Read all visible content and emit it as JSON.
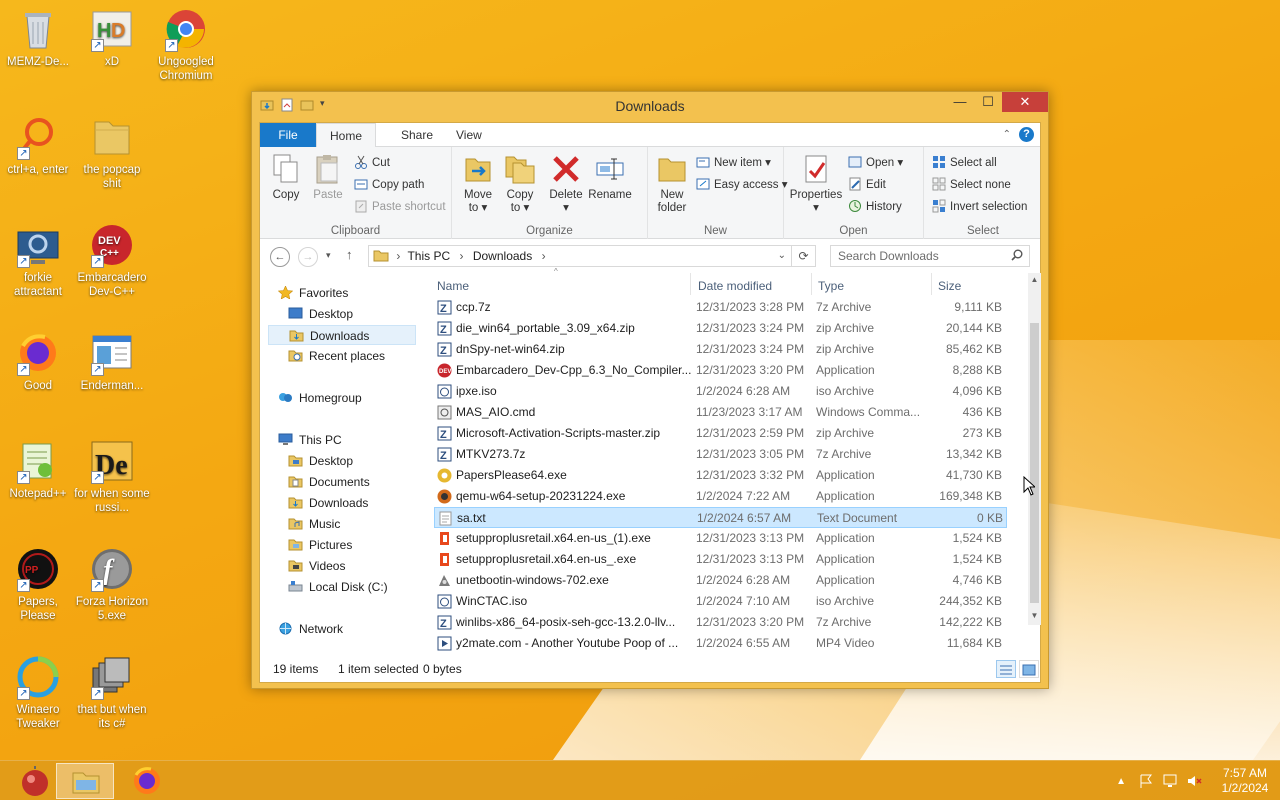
{
  "desktop": {
    "icons": [
      {
        "label": "MEMZ-De...",
        "icon": "recycle-bin"
      },
      {
        "label": "xD",
        "icon": "hxd"
      },
      {
        "label": "Ungoogled Chromium",
        "icon": "chromium"
      },
      {
        "label": "ctrl+a, enter",
        "icon": "search-shortcut"
      },
      {
        "label": "the popcap shit",
        "icon": "folder"
      },
      {
        "label": "forkie attractant",
        "icon": "settings-computer"
      },
      {
        "label": "Embarcadero Dev-C++",
        "icon": "devcpp"
      },
      {
        "label": "Good",
        "icon": "firefox"
      },
      {
        "label": "Enderman...",
        "icon": "window-app"
      },
      {
        "label": "Notepad++",
        "icon": "notepad-plus"
      },
      {
        "label": "for when some russi...",
        "icon": "de-app"
      },
      {
        "label": "Papers, Please",
        "icon": "papers-please"
      },
      {
        "label": "Forza Horizon 5.exe",
        "icon": "flash"
      },
      {
        "label": "Winaero Tweaker",
        "icon": "winaero"
      },
      {
        "label": "that but when its c#",
        "icon": "multi-window"
      }
    ]
  },
  "window": {
    "title": "Downloads",
    "controls": {
      "minimize": "—",
      "maximize": "☐",
      "close": "✕"
    }
  },
  "ribbon": {
    "tabs": {
      "file": "File",
      "home": "Home",
      "share": "Share",
      "view": "View"
    },
    "clipboard": {
      "label": "Clipboard",
      "copy": "Copy",
      "paste": "Paste",
      "cut": "Cut",
      "copy_path": "Copy path",
      "paste_shortcut": "Paste shortcut"
    },
    "organize": {
      "label": "Organize",
      "move_to": "Move",
      "move_to2": "to ▾",
      "copy_to": "Copy",
      "copy_to2": "to ▾",
      "delete": "Delete",
      "delete2": "▾",
      "rename": "Rename"
    },
    "new": {
      "label": "New",
      "new_folder": "New",
      "new_folder2": "folder",
      "new_item": "New item ▾",
      "easy_access": "Easy access ▾"
    },
    "open": {
      "label": "Open",
      "properties": "Properties",
      "properties2": "▾",
      "open": "Open ▾",
      "edit": "Edit",
      "history": "History"
    },
    "select": {
      "label": "Select",
      "select_all": "Select all",
      "select_none": "Select none",
      "invert": "Invert selection"
    }
  },
  "address": {
    "path": [
      "This PC",
      "Downloads"
    ],
    "sep": "›",
    "search_placeholder": "Search Downloads"
  },
  "nav": {
    "favorites": "Favorites",
    "desktop": "Desktop",
    "downloads": "Downloads",
    "recent": "Recent places",
    "homegroup": "Homegroup",
    "thispc": "This PC",
    "pc_desktop": "Desktop",
    "documents": "Documents",
    "pc_downloads": "Downloads",
    "music": "Music",
    "pictures": "Pictures",
    "videos": "Videos",
    "localdisk": "Local Disk (C:)",
    "network": "Network"
  },
  "columns": {
    "name": "Name",
    "date": "Date modified",
    "type": "Type",
    "size": "Size"
  },
  "files": [
    {
      "name": "ccp.7z",
      "date": "12/31/2023 3:28 PM",
      "type": "7z Archive",
      "size": "9,111 KB",
      "icon": "archive"
    },
    {
      "name": "die_win64_portable_3.09_x64.zip",
      "date": "12/31/2023 3:24 PM",
      "type": "zip Archive",
      "size": "20,144 KB",
      "icon": "archive"
    },
    {
      "name": "dnSpy-net-win64.zip",
      "date": "12/31/2023 3:24 PM",
      "type": "zip Archive",
      "size": "85,462 KB",
      "icon": "archive"
    },
    {
      "name": "Embarcadero_Dev-Cpp_6.3_No_Compiler...",
      "date": "12/31/2023 3:20 PM",
      "type": "Application",
      "size": "8,288 KB",
      "icon": "devcpp"
    },
    {
      "name": "ipxe.iso",
      "date": "1/2/2024 6:28 AM",
      "type": "iso Archive",
      "size": "4,096 KB",
      "icon": "iso"
    },
    {
      "name": "MAS_AIO.cmd",
      "date": "11/23/2023 3:17 AM",
      "type": "Windows Comma...",
      "size": "436 KB",
      "icon": "cmd"
    },
    {
      "name": "Microsoft-Activation-Scripts-master.zip",
      "date": "12/31/2023 2:59 PM",
      "type": "zip Archive",
      "size": "273 KB",
      "icon": "archive"
    },
    {
      "name": "MTKV273.7z",
      "date": "12/31/2023 3:05 PM",
      "type": "7z Archive",
      "size": "13,342 KB",
      "icon": "archive"
    },
    {
      "name": "PapersPlease64.exe",
      "date": "12/31/2023 3:32 PM",
      "type": "Application",
      "size": "41,730 KB",
      "icon": "papers"
    },
    {
      "name": "qemu-w64-setup-20231224.exe",
      "date": "1/2/2024 7:22 AM",
      "type": "Application",
      "size": "169,348 KB",
      "icon": "qemu"
    },
    {
      "name": "sa.txt",
      "date": "1/2/2024 6:57 AM",
      "type": "Text Document",
      "size": "0 KB",
      "icon": "text"
    },
    {
      "name": "setupproplusretail.x64.en-us_(1).exe",
      "date": "12/31/2023 3:13 PM",
      "type": "Application",
      "size": "1,524 KB",
      "icon": "office"
    },
    {
      "name": "setupproplusretail.x64.en-us_.exe",
      "date": "12/31/2023 3:13 PM",
      "type": "Application",
      "size": "1,524 KB",
      "icon": "office"
    },
    {
      "name": "unetbootin-windows-702.exe",
      "date": "1/2/2024 6:28 AM",
      "type": "Application",
      "size": "4,746 KB",
      "icon": "unetbootin"
    },
    {
      "name": "WinCTAC.iso",
      "date": "1/2/2024 7:10 AM",
      "type": "iso Archive",
      "size": "244,352 KB",
      "icon": "iso"
    },
    {
      "name": "winlibs-x86_64-posix-seh-gcc-13.2.0-llv...",
      "date": "12/31/2023 3:20 PM",
      "type": "7z Archive",
      "size": "142,222 KB",
      "icon": "archive"
    },
    {
      "name": "y2mate.com - Another Youtube Poop of ...",
      "date": "1/2/2024 6:55 AM",
      "type": "MP4 Video",
      "size": "11,684 KB",
      "icon": "video"
    }
  ],
  "selected_file": "sa.txt",
  "status": {
    "items": "19 items",
    "selected": "1 item selected",
    "bytes": "0 bytes"
  },
  "taskbar": {
    "time": "7:57 AM",
    "date": "1/2/2024"
  },
  "colors": {
    "accent": "#1979ca",
    "selection": "#cce8ff",
    "desktop": "#f4a812",
    "close": "#c7403a"
  }
}
